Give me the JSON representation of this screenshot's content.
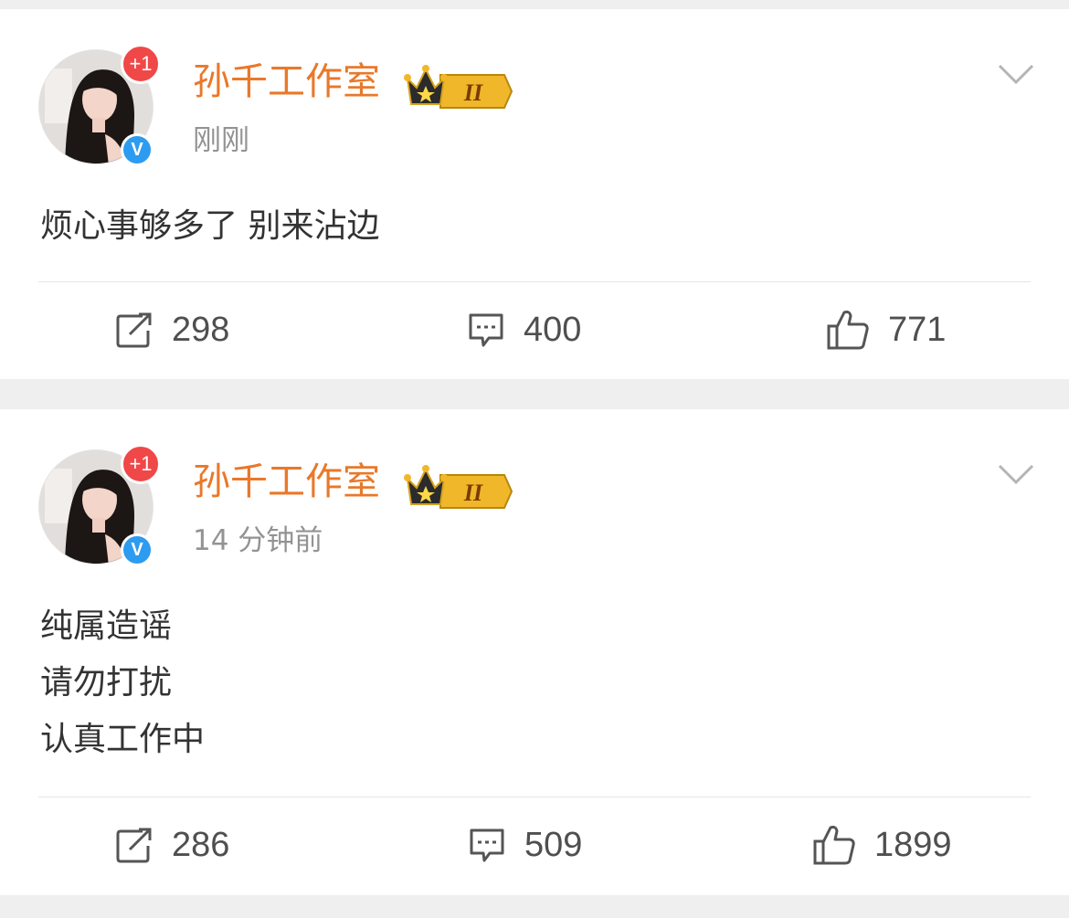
{
  "posts": [
    {
      "username": "孙千工作室",
      "time": "刚刚",
      "plus_badge": "+1",
      "verified_badge": "V",
      "crown_level": "II",
      "content": [
        "烦心事够多了 别来沾边"
      ],
      "stats": {
        "repost": "298",
        "comment": "400",
        "like": "771"
      }
    },
    {
      "username": "孙千工作室",
      "time": "14 分钟前",
      "plus_badge": "+1",
      "verified_badge": "V",
      "crown_level": "II",
      "content": [
        "纯属造谣",
        "请勿打扰",
        "认真工作中"
      ],
      "stats": {
        "repost": "286",
        "comment": "509",
        "like": "1899"
      }
    }
  ],
  "icons": {
    "repost": "repost-icon",
    "comment": "comment-icon",
    "like": "like-icon",
    "more": "chevron-down-icon",
    "crown": "crown-icon"
  },
  "colors": {
    "username": "#e9782a",
    "plus_badge": "#f04848",
    "verified_badge": "#2d9bf0",
    "background": "#efefef"
  }
}
